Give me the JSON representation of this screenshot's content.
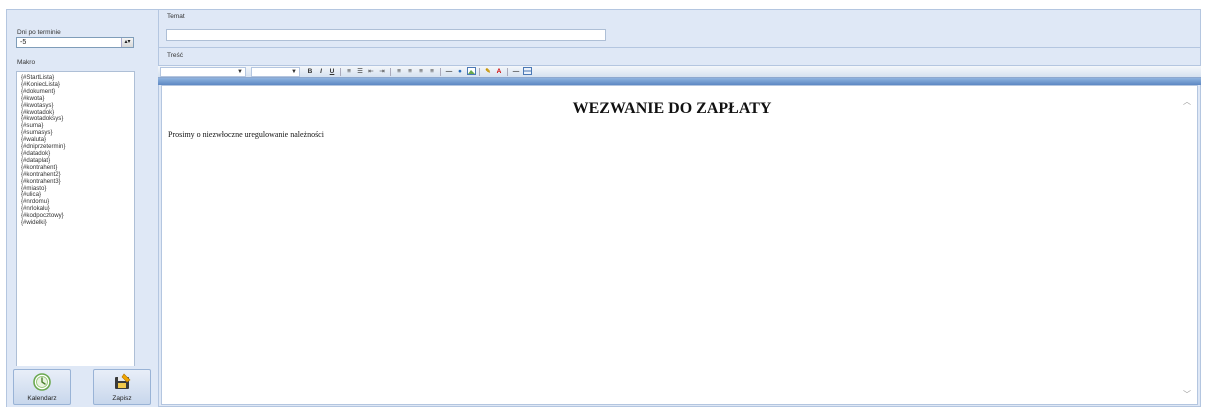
{
  "left": {
    "dni_label": "Dni po terminie",
    "dni_value": "-5",
    "makro_label": "Makro",
    "macros": [
      "{#StartLista}",
      "{#KoniecLista}",
      "{#dokument}",
      "{#kwota}",
      "{#kwotasys}",
      "{#kwotadok}",
      "{#kwotadoksys}",
      "{#suma}",
      "{#sumasys}",
      "{#waluta}",
      "{#dniprzetermin}",
      "{#datadok}",
      "{#dataplat}",
      "{#kontrahent}",
      "{#kontrahent2}",
      "{#kontrahent3}",
      "{#miasto}",
      "{#ulica}",
      "{#nrdomu}",
      "{#nrlokalu}",
      "{#kodpocztowy}",
      "{#widelki}"
    ],
    "buttons": {
      "calendar": "Kalendarz",
      "save": "Zapisz"
    }
  },
  "right": {
    "temat_label": "Temat",
    "temat_value": "",
    "tresc_label": "Treść",
    "heading": "WEZWANIE DO ZAPŁATY",
    "body": "Prosimy o niezwłoczne uregulowanie należności"
  },
  "toolbar": {
    "bold": "B",
    "italic": "I",
    "underline": "U",
    "icons": [
      "ordered-list-icon",
      "unordered-list-icon",
      "outdent-icon",
      "indent-icon",
      "align-left-icon",
      "align-center-icon",
      "align-right-icon",
      "justify-icon",
      "horizontal-rule-icon",
      "link-icon",
      "image-icon",
      "highlight-icon",
      "font-color-icon",
      "line-icon",
      "table-icon"
    ]
  },
  "colors": {
    "panel": "#dfe8f6",
    "border": "#b4c6e0",
    "accent": "#5d88c3"
  }
}
